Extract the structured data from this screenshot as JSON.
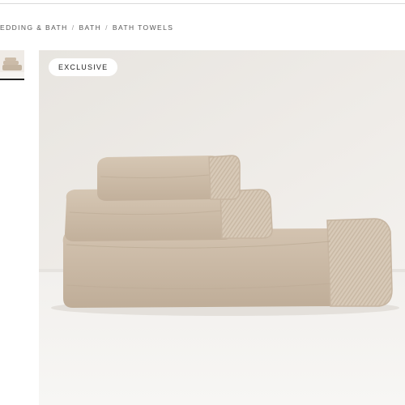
{
  "breadcrumb": {
    "items": [
      "EDDING & BATH",
      "BATH",
      "BATH TOWELS"
    ],
    "separator": "/"
  },
  "product_image": {
    "badge": "EXCLUSIVE",
    "subject": "stacked towels",
    "towel_color": "#c9b8a5"
  },
  "thumbnails": {
    "selected_index": 0
  }
}
